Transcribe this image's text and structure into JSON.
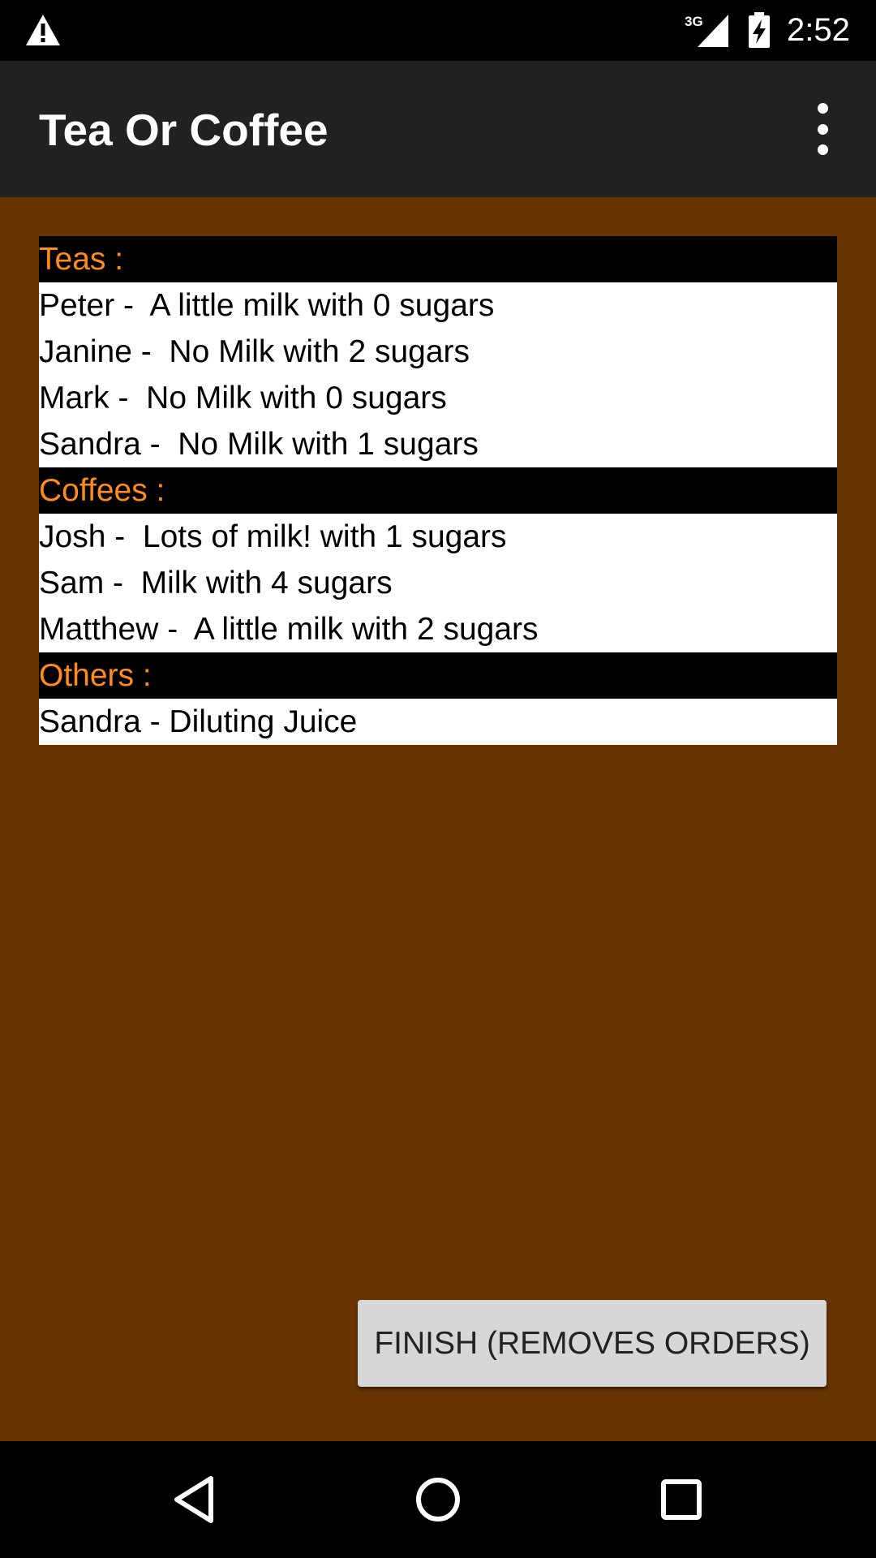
{
  "status_bar": {
    "network": "3G",
    "time": "2:52"
  },
  "app_bar": {
    "title": "Tea Or Coffee"
  },
  "orders": {
    "teas": {
      "header": "Teas :",
      "items": [
        "Peter -  A little milk with 0 sugars",
        "Janine -  No Milk with 2 sugars",
        "Mark -  No Milk with 0 sugars",
        "Sandra -  No Milk with 1 sugars"
      ]
    },
    "coffees": {
      "header": "Coffees :",
      "items": [
        "Josh -  Lots of milk! with 1 sugars",
        "Sam -  Milk with 4 sugars",
        "Matthew -  A little milk with 2 sugars"
      ]
    },
    "others": {
      "header": "Others :",
      "items": [
        "Sandra - Diluting Juice"
      ]
    }
  },
  "finish_button": {
    "label": "FINISH (REMOVES ORDERS)"
  },
  "colors": {
    "background": "#673300",
    "header_text": "#ff8c1a",
    "app_bar": "#212121"
  },
  "icons": {
    "status": [
      "warning-icon",
      "signal-icon",
      "battery-charging-icon"
    ],
    "app_bar": [
      "overflow-menu-icon"
    ],
    "navigation": [
      "back-icon",
      "home-icon",
      "recents-icon"
    ]
  }
}
